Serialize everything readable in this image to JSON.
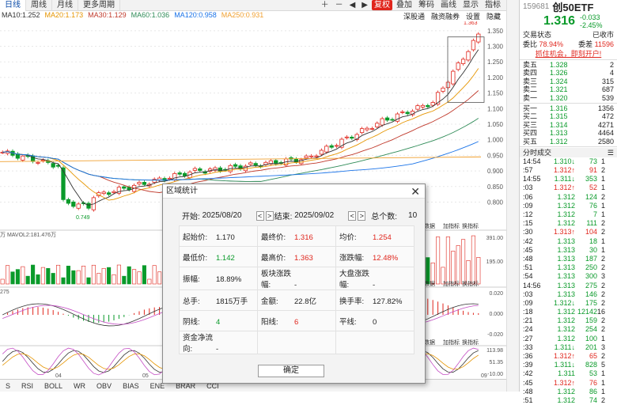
{
  "topbar": {
    "periods": [
      "日线",
      "周线",
      "月线",
      "更多周期"
    ],
    "right_buttons": [
      "复权",
      "叠加",
      "筹码",
      "画线",
      "显示",
      "指标"
    ],
    "sub_buttons": [
      "深股通",
      "融资融券",
      "设置",
      "隐藏"
    ]
  },
  "ma_legend": [
    {
      "text": "MA10:1.252",
      "color": "#333333"
    },
    {
      "text": "MA20:1.173",
      "color": "#e69500"
    },
    {
      "text": "MA30:1.129",
      "color": "#c0392b"
    },
    {
      "text": "MA60:1.036",
      "color": "#2e8b57"
    },
    {
      "text": "MA120:0.958",
      "color": "#1a73e8"
    },
    {
      "text": "MA250:0.931",
      "color": "#f0a030"
    }
  ],
  "chart_labels": {
    "high_marker": "1.363",
    "low_marker": "0.749",
    "vol_legend": "万  MAVOL2:181.476万",
    "macd_legend": "275",
    "x_ticks": [
      "04",
      "05",
      "09"
    ],
    "sub_tools": [
      "数据",
      "加指标",
      "换指标"
    ]
  },
  "price_axis": [
    "1.350",
    "1.300",
    "1.250",
    "1.200",
    "1.150",
    "1.100",
    "1.050",
    "1.000",
    "0.950",
    "0.900",
    "0.850",
    "0.800"
  ],
  "vol_axis": [
    "391.00",
    "195.00",
    "万"
  ],
  "macd_axis": [
    "0.020",
    "0.000",
    "-0.020"
  ],
  "kdj_axis": [
    "113.98",
    "51.35",
    "-10.00"
  ],
  "bottom_tabs": [
    "S",
    "RSI",
    "BOLL",
    "WR",
    "OBV",
    "BIAS",
    "ENE",
    "BRAR",
    "CCI"
  ],
  "right_panel": {
    "code": "159681",
    "name": "创50ETF",
    "price": "1.316",
    "change": "-0.033",
    "change_pct": "-2.45%",
    "status_label": "交易状态",
    "status_value": "已收市",
    "weibi_label": "委比",
    "weibi_value": "78.94%",
    "weicha_label": "委差",
    "weicha_value": "11596",
    "ad_text": "抓住机会，即刻开户!",
    "asks": [
      {
        "label": "卖五",
        "price": "1.328",
        "vol": "2"
      },
      {
        "label": "卖四",
        "price": "1.326",
        "vol": "4"
      },
      {
        "label": "卖三",
        "price": "1.324",
        "vol": "315"
      },
      {
        "label": "卖二",
        "price": "1.321",
        "vol": "687"
      },
      {
        "label": "卖一",
        "price": "1.320",
        "vol": "539"
      }
    ],
    "bids": [
      {
        "label": "买一",
        "price": "1.316",
        "vol": "1356"
      },
      {
        "label": "买二",
        "price": "1.315",
        "vol": "472"
      },
      {
        "label": "买三",
        "price": "1.314",
        "vol": "4271"
      },
      {
        "label": "买四",
        "price": "1.313",
        "vol": "4464"
      },
      {
        "label": "买五",
        "price": "1.312",
        "vol": "2580"
      }
    ],
    "ticks_title": "分时成交",
    "ticks": [
      {
        "t": "14:54",
        "p": "1.310",
        "d": "down",
        "v": "73",
        "n": "1"
      },
      {
        "t": ":57",
        "p": "1.312",
        "d": "up",
        "v": "91",
        "n": "2"
      },
      {
        "t": "14:55",
        "p": "1.311",
        "d": "down",
        "v": "353",
        "n": "1"
      },
      {
        "t": ":03",
        "p": "1.312",
        "d": "up",
        "v": "52",
        "n": "1"
      },
      {
        "t": ":06",
        "p": "1.312",
        "d": "",
        "v": "124",
        "n": "2"
      },
      {
        "t": ":09",
        "p": "1.312",
        "d": "",
        "v": "76",
        "n": "1"
      },
      {
        "t": ":12",
        "p": "1.312",
        "d": "",
        "v": "7",
        "n": "1"
      },
      {
        "t": ":15",
        "p": "1.312",
        "d": "",
        "v": "111",
        "n": "2"
      },
      {
        "t": ":30",
        "p": "1.313",
        "d": "up",
        "v": "104",
        "n": "2"
      },
      {
        "t": ":42",
        "p": "1.313",
        "d": "",
        "v": "18",
        "n": "1"
      },
      {
        "t": ":45",
        "p": "1.313",
        "d": "",
        "v": "30",
        "n": "1"
      },
      {
        "t": ":48",
        "p": "1.313",
        "d": "",
        "v": "187",
        "n": "2"
      },
      {
        "t": ":51",
        "p": "1.313",
        "d": "",
        "v": "250",
        "n": "2"
      },
      {
        "t": ":54",
        "p": "1.313",
        "d": "",
        "v": "300",
        "n": "3"
      },
      {
        "t": "14:56",
        "p": "1.313",
        "d": "",
        "v": "275",
        "n": "2"
      },
      {
        "t": ":03",
        "p": "1.313",
        "d": "",
        "v": "146",
        "n": "2"
      },
      {
        "t": ":09",
        "p": "1.312",
        "d": "down",
        "v": "175",
        "n": "2"
      },
      {
        "t": ":18",
        "p": "1.312",
        "d": "",
        "v": "12142",
        "n": "16"
      },
      {
        "t": ":21",
        "p": "1.312",
        "d": "",
        "v": "159",
        "n": "2"
      },
      {
        "t": ":24",
        "p": "1.312",
        "d": "",
        "v": "254",
        "n": "2"
      },
      {
        "t": ":27",
        "p": "1.312",
        "d": "",
        "v": "100",
        "n": "1"
      },
      {
        "t": ":33",
        "p": "1.311",
        "d": "down",
        "v": "201",
        "n": "3"
      },
      {
        "t": ":36",
        "p": "1.312",
        "d": "up",
        "v": "65",
        "n": "2"
      },
      {
        "t": ":39",
        "p": "1.311",
        "d": "down",
        "v": "828",
        "n": "5"
      },
      {
        "t": ":42",
        "p": "1.311",
        "d": "",
        "v": "53",
        "n": "1"
      },
      {
        "t": ":45",
        "p": "1.312",
        "d": "up",
        "v": "76",
        "n": "1"
      },
      {
        "t": ":48",
        "p": "1.312",
        "d": "",
        "v": "86",
        "n": "1"
      },
      {
        "t": ":51",
        "p": "1.312",
        "d": "",
        "v": "74",
        "n": "2"
      }
    ]
  },
  "dialog": {
    "title": "区域统计",
    "start_label": "开始:",
    "start_value": "2025/08/20",
    "end_label": "结束:",
    "end_value": "2025/09/02",
    "count_label": "总个数:",
    "count_value": "10",
    "rows": [
      [
        {
          "l": "起始价:",
          "v": "1.170",
          "c": "#222"
        },
        {
          "l": "最终价:",
          "v": "1.316",
          "c": "#e0261d"
        },
        {
          "l": "均价:",
          "v": "1.254",
          "c": "#e0261d"
        }
      ],
      [
        {
          "l": "最低价:",
          "v": "1.142",
          "c": "#0a9a2a"
        },
        {
          "l": "最高价:",
          "v": "1.363",
          "c": "#e0261d"
        },
        {
          "l": "涨跌幅:",
          "v": "12.48%",
          "c": "#e0261d"
        }
      ],
      [
        {
          "l": "振幅:",
          "v": "18.89%",
          "c": "#222"
        },
        {
          "l": "板块涨跌幅:",
          "v": "-",
          "c": "#222"
        },
        {
          "l": "大盘涨跌幅:",
          "v": "-",
          "c": "#222"
        }
      ],
      [
        {
          "l": "总手:",
          "v": "1815万手",
          "c": "#222"
        },
        {
          "l": "金额:",
          "v": "22.8亿",
          "c": "#222"
        },
        {
          "l": "换手率:",
          "v": "127.82%",
          "c": "#222"
        }
      ],
      [
        {
          "l": "阴线:",
          "v": "4",
          "c": "#0a9a2a"
        },
        {
          "l": "阳线:",
          "v": "6",
          "c": "#e0261d"
        },
        {
          "l": "平线:",
          "v": "0",
          "c": "#222"
        }
      ],
      [
        {
          "l": "资金净流向:",
          "v": "-",
          "c": "#222"
        },
        {
          "l": "",
          "v": "",
          "c": "#222"
        },
        {
          "l": "",
          "v": "",
          "c": "#222"
        }
      ]
    ],
    "ok_label": "确定"
  }
}
